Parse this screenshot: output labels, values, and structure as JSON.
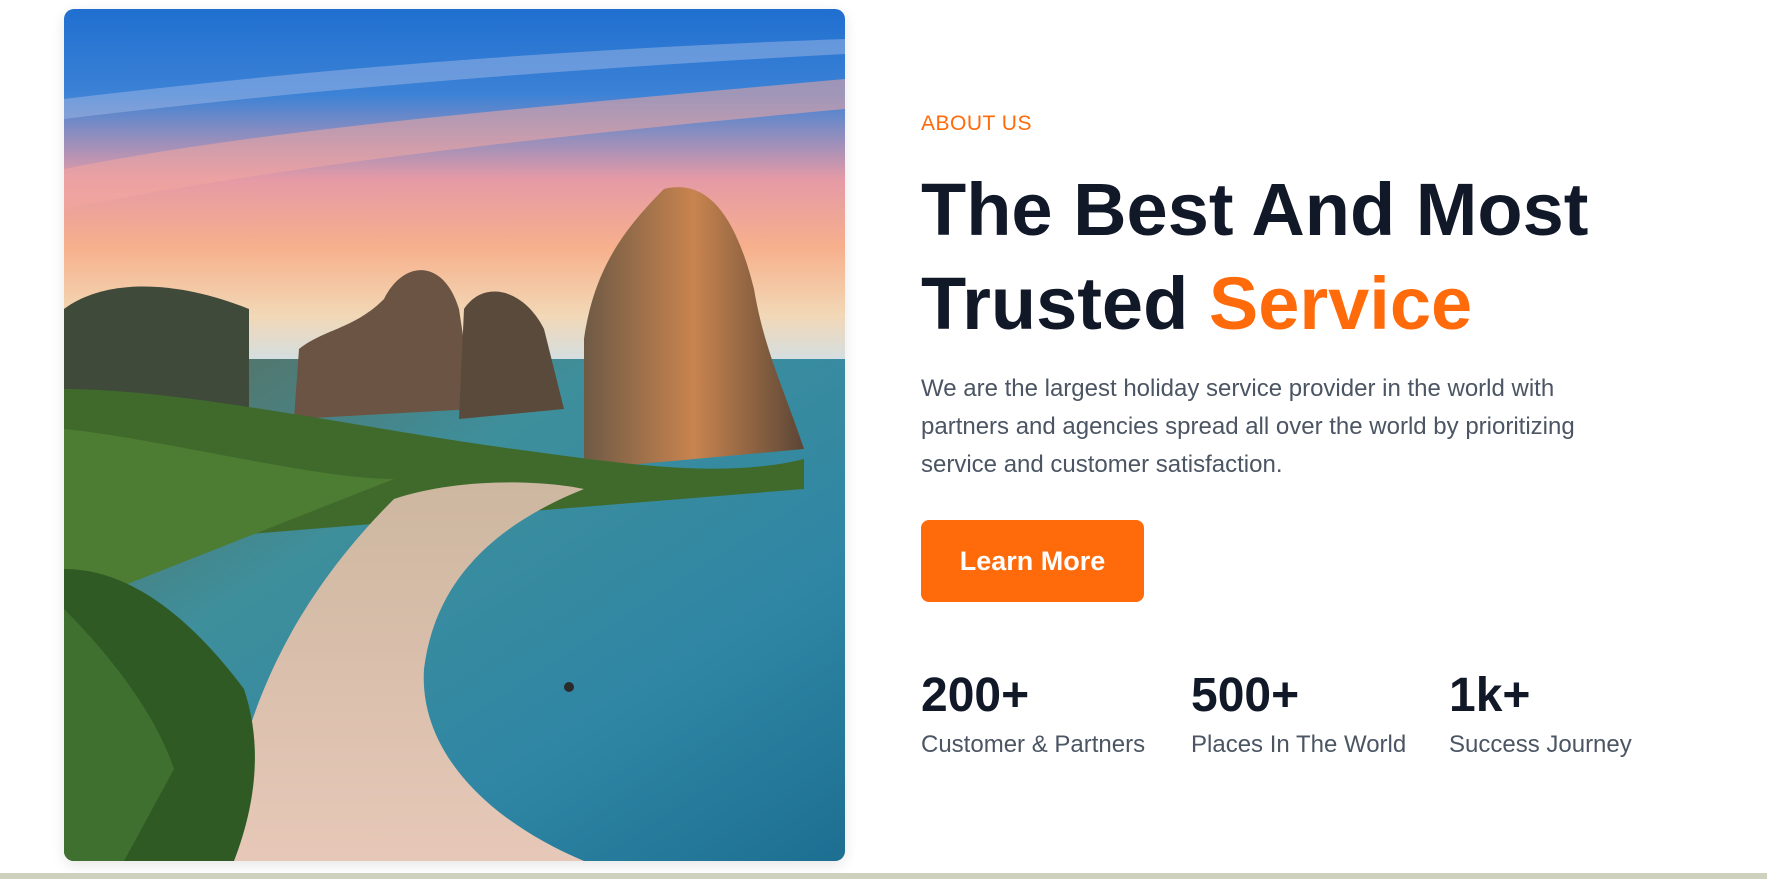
{
  "about": {
    "eyebrow": "ABOUT US",
    "headline_line1": "The Best And Most",
    "headline_line2_plain": "Trusted ",
    "headline_line2_accent": "Service",
    "description": "We are the largest holiday service provider in the world with partners and agencies spread all over the world by prioritizing service and customer satisfaction.",
    "cta_label": "Learn More"
  },
  "stats": [
    {
      "value": "200+",
      "label": "Customer & Partners"
    },
    {
      "value": "500+",
      "label": "Places In The World"
    },
    {
      "value": "1k+",
      "label": "Success Journey"
    }
  ],
  "colors": {
    "accent": "#ff6b0a",
    "heading": "#111827",
    "body_text": "#4b5563",
    "bottom_line": "#cfd1bf"
  },
  "hero_image": {
    "icon": "beach-cliffs-photo"
  }
}
